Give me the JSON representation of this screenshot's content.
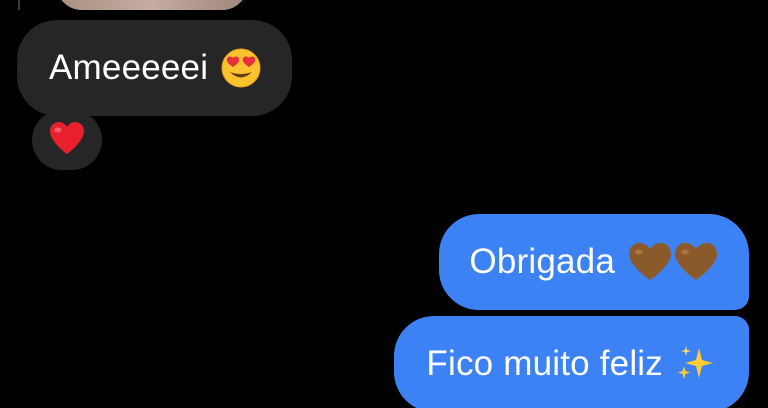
{
  "messages": [
    {
      "direction": "incoming",
      "type": "photo",
      "cropped": true
    },
    {
      "direction": "incoming",
      "text": "Ameeeeei",
      "emoji": "heart-eyes-emoji"
    },
    {
      "direction": "incoming",
      "type": "reaction",
      "emoji": "red-heart-emoji"
    },
    {
      "direction": "outgoing",
      "text": "Obrigada",
      "emoji": "brown-hearts-emoji"
    },
    {
      "direction": "outgoing",
      "text": "Fico muito feliz",
      "emoji": "sparkles-emoji"
    }
  ],
  "colors": {
    "background": "#000000",
    "incoming_bubble": "#262626",
    "outgoing_bubble": "#3d82f5",
    "text": "#ffffff"
  }
}
